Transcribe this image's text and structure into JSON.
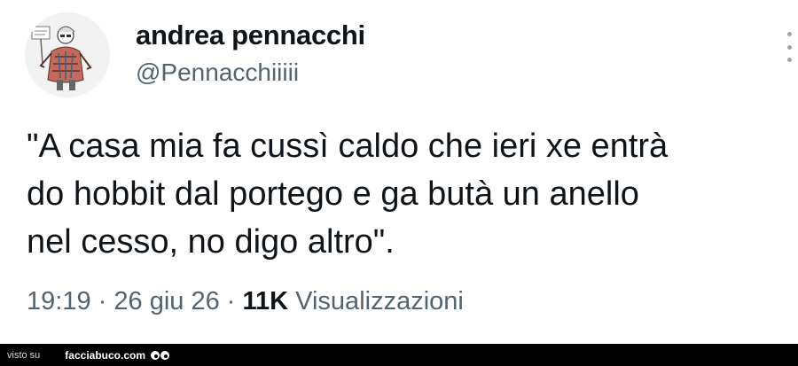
{
  "author": {
    "display_name": "andrea pennacchi",
    "handle": "@Pennacchiiiii",
    "avatar_icon": "caricature-avatar"
  },
  "tweet": {
    "text_lines": [
      "\"A casa mia fa cussì caldo che ieri xe entrà",
      "do hobbit dal portego e ga butà un anello",
      "nel cesso, no digo altro\"."
    ]
  },
  "meta": {
    "time": "19:19",
    "separator": "·",
    "date": "26 giu 26",
    "views_count": "11K",
    "views_label": "Visualizzazioni"
  },
  "footer": {
    "visto_su": "visto su",
    "site": "facciabuco.com"
  },
  "colors": {
    "text_primary": "#0f1419",
    "text_secondary": "#536471",
    "footer_bg": "#000000"
  }
}
